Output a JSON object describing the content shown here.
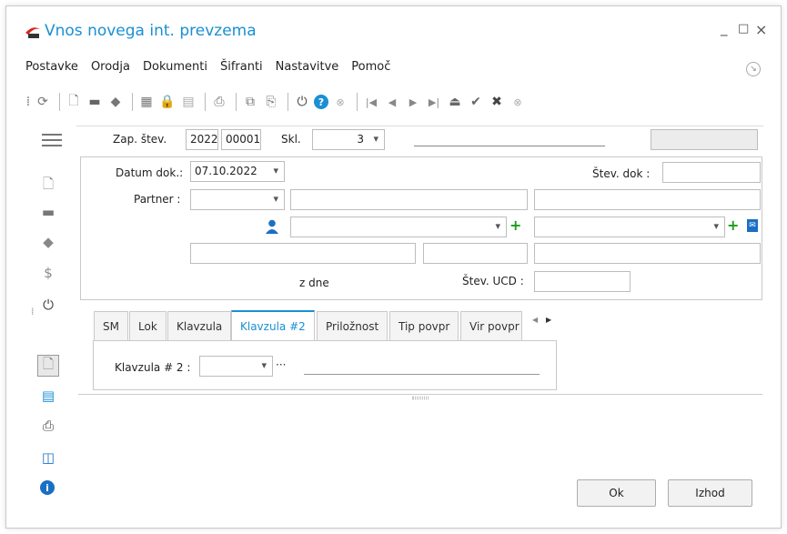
{
  "window": {
    "title": "Vnos novega int. prevzema",
    "minimize": "_",
    "maximize": "□",
    "close": "×"
  },
  "menu": [
    "Postavke",
    "Orodja",
    "Dokumenti",
    "Šifranti",
    "Nastavitve",
    "Pomoč"
  ],
  "header": {
    "zap_label": "Zap. štev.",
    "zap_year": "2022",
    "zap_number": "00001",
    "skl_label": "Skl.",
    "skl_value": "3"
  },
  "form": {
    "datum_label": "Datum dok.:",
    "datum_value": "07.10.2022",
    "stev_dok_label": "Štev. dok :",
    "partner_label": "Partner :",
    "z_dne_label": "z dne",
    "stev_ucd_label": "Štev. UCD :"
  },
  "tabs": [
    "SM",
    "Lok",
    "Klavzula",
    "Klavzula #2",
    "Priložnost",
    "Tip povpr",
    "Vir povpr"
  ],
  "active_tab": "Klavzula #2",
  "tab_content": {
    "klavzula2_label": "Klavzula # 2 :",
    "ellipsis": "···"
  },
  "buttons": {
    "ok": "Ok",
    "izhod": "Izhod"
  },
  "icons": {
    "app_logo": "app-logo-icon",
    "accent_color": "#1a8fd4",
    "green": "#1a9e1a"
  }
}
